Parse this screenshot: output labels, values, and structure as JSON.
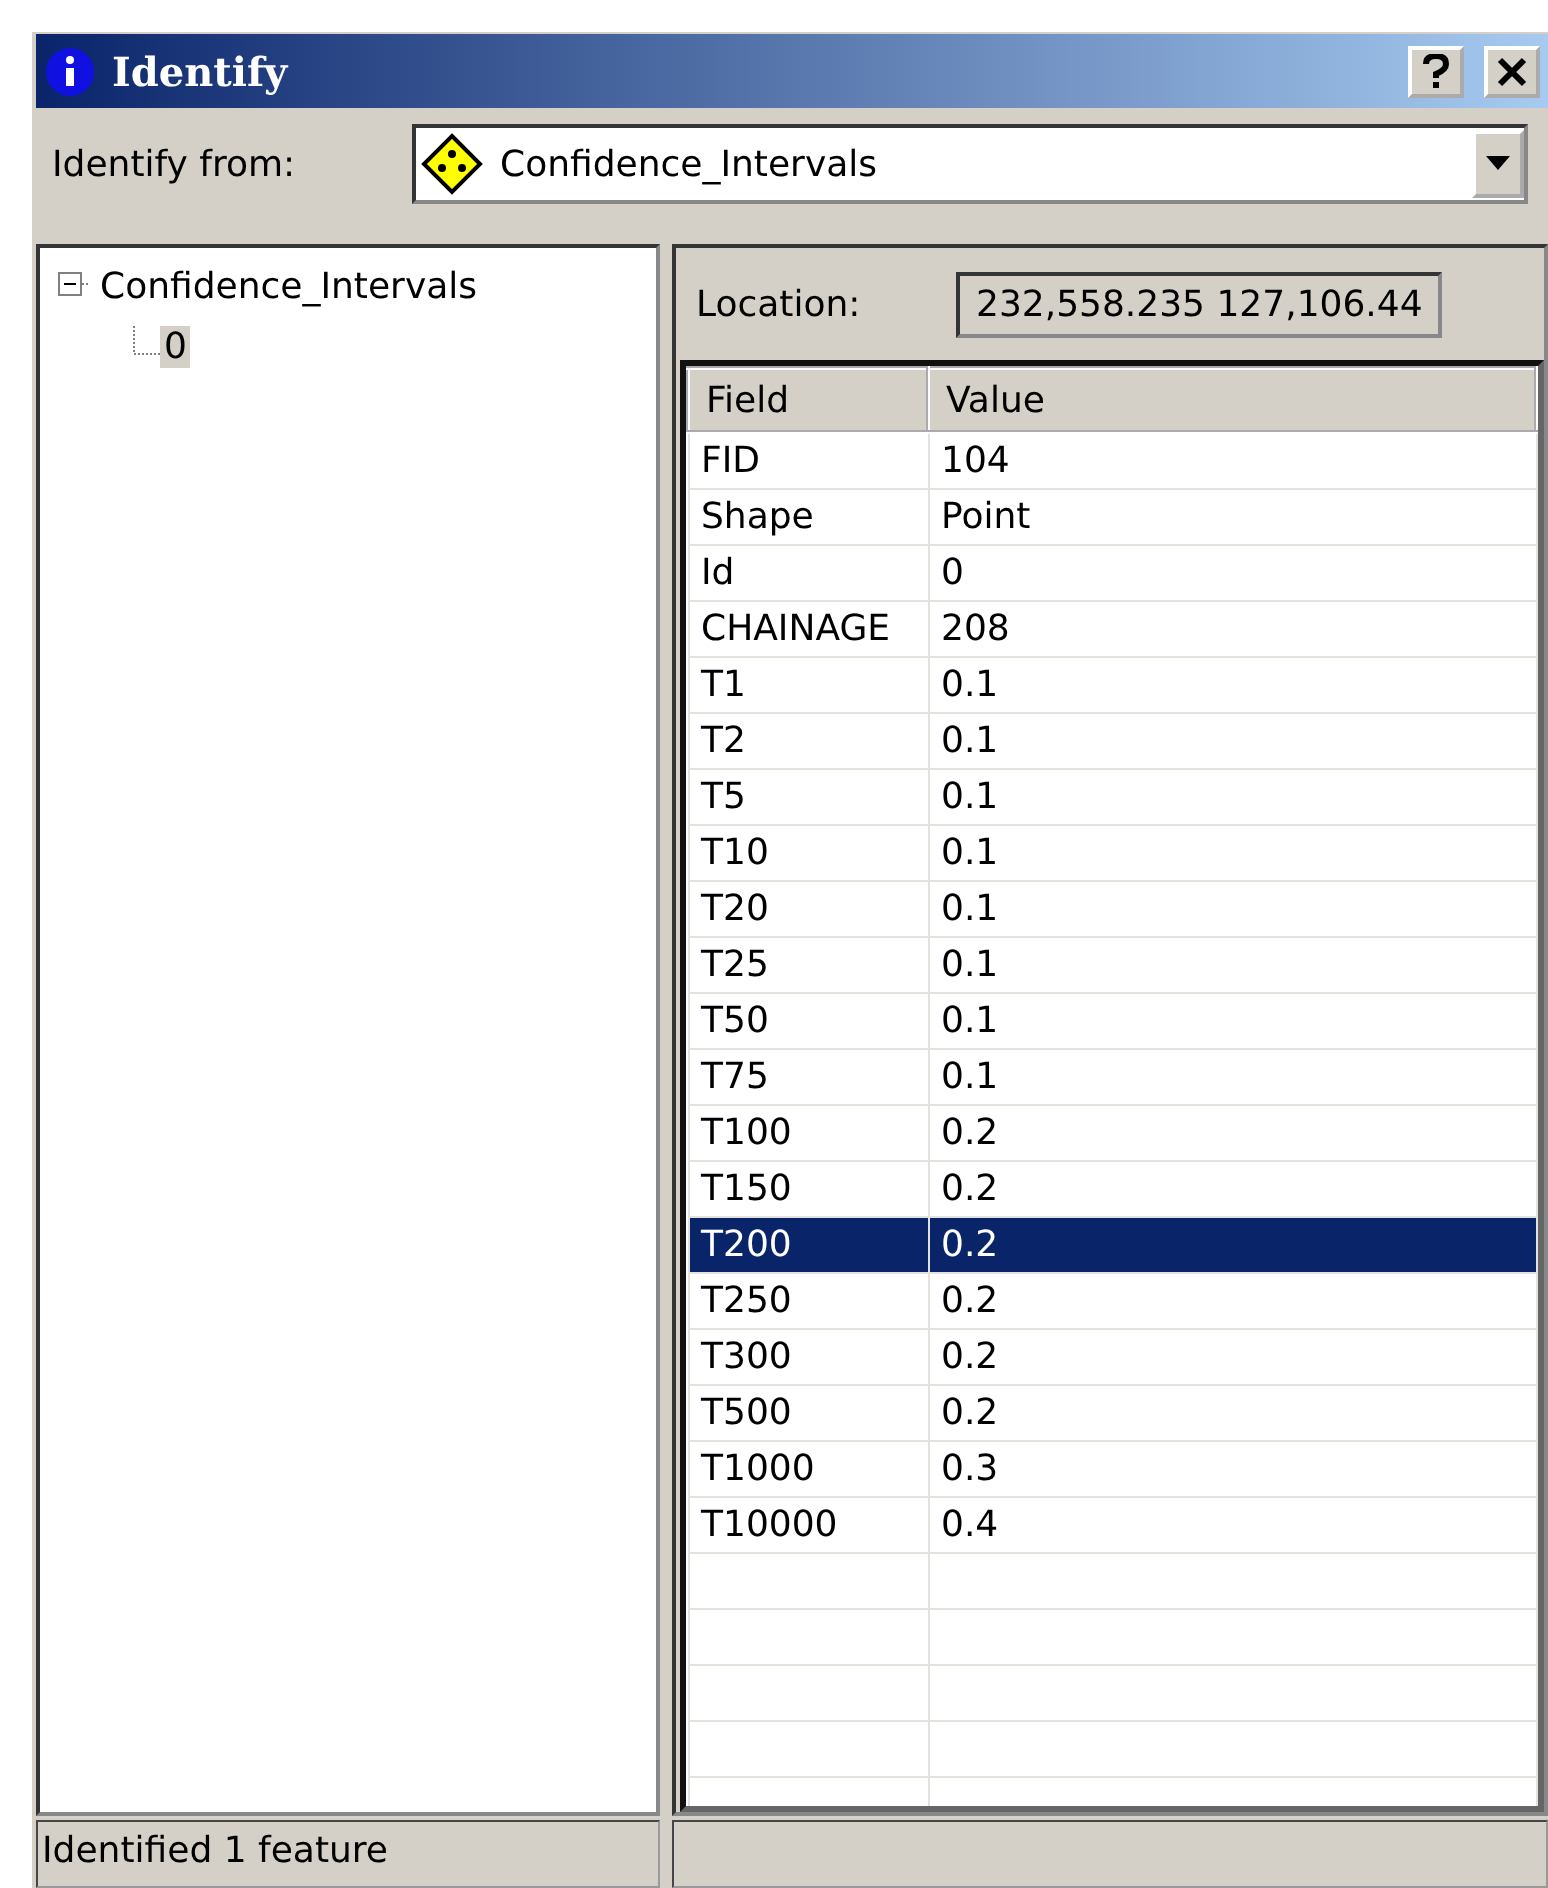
{
  "window": {
    "title": "Identify"
  },
  "identify_from": {
    "label": "Identify from:",
    "value": "Confidence_Intervals"
  },
  "tree": [
    {
      "label": "Confidence_Intervals",
      "expanded": true,
      "selected": false,
      "children": [
        {
          "label": "0",
          "selected": true
        }
      ]
    }
  ],
  "location": {
    "label": "Location:",
    "value": "232,558.235  127,106.44"
  },
  "table": {
    "columns": [
      "Field",
      "Value"
    ],
    "rows": [
      {
        "field": "FID",
        "value": "104",
        "selected": false
      },
      {
        "field": "Shape",
        "value": "Point",
        "selected": false
      },
      {
        "field": "Id",
        "value": "0",
        "selected": false
      },
      {
        "field": "CHAINAGE",
        "value": "208",
        "selected": false
      },
      {
        "field": "T1",
        "value": "0.1",
        "selected": false
      },
      {
        "field": "T2",
        "value": "0.1",
        "selected": false
      },
      {
        "field": "T5",
        "value": "0.1",
        "selected": false
      },
      {
        "field": "T10",
        "value": "0.1",
        "selected": false
      },
      {
        "field": "T20",
        "value": "0.1",
        "selected": false
      },
      {
        "field": "T25",
        "value": "0.1",
        "selected": false
      },
      {
        "field": "T50",
        "value": "0.1",
        "selected": false
      },
      {
        "field": "T75",
        "value": "0.1",
        "selected": false
      },
      {
        "field": "T100",
        "value": "0.2",
        "selected": false
      },
      {
        "field": "T150",
        "value": "0.2",
        "selected": false
      },
      {
        "field": "T200",
        "value": "0.2",
        "selected": true
      },
      {
        "field": "T250",
        "value": "0.2",
        "selected": false
      },
      {
        "field": "T300",
        "value": "0.2",
        "selected": false
      },
      {
        "field": "T500",
        "value": "0.2",
        "selected": false
      },
      {
        "field": "T1000",
        "value": "0.3",
        "selected": false
      },
      {
        "field": "T10000",
        "value": "0.4",
        "selected": false
      }
    ]
  },
  "status_bar": {
    "text": "Identified 1 feature"
  }
}
